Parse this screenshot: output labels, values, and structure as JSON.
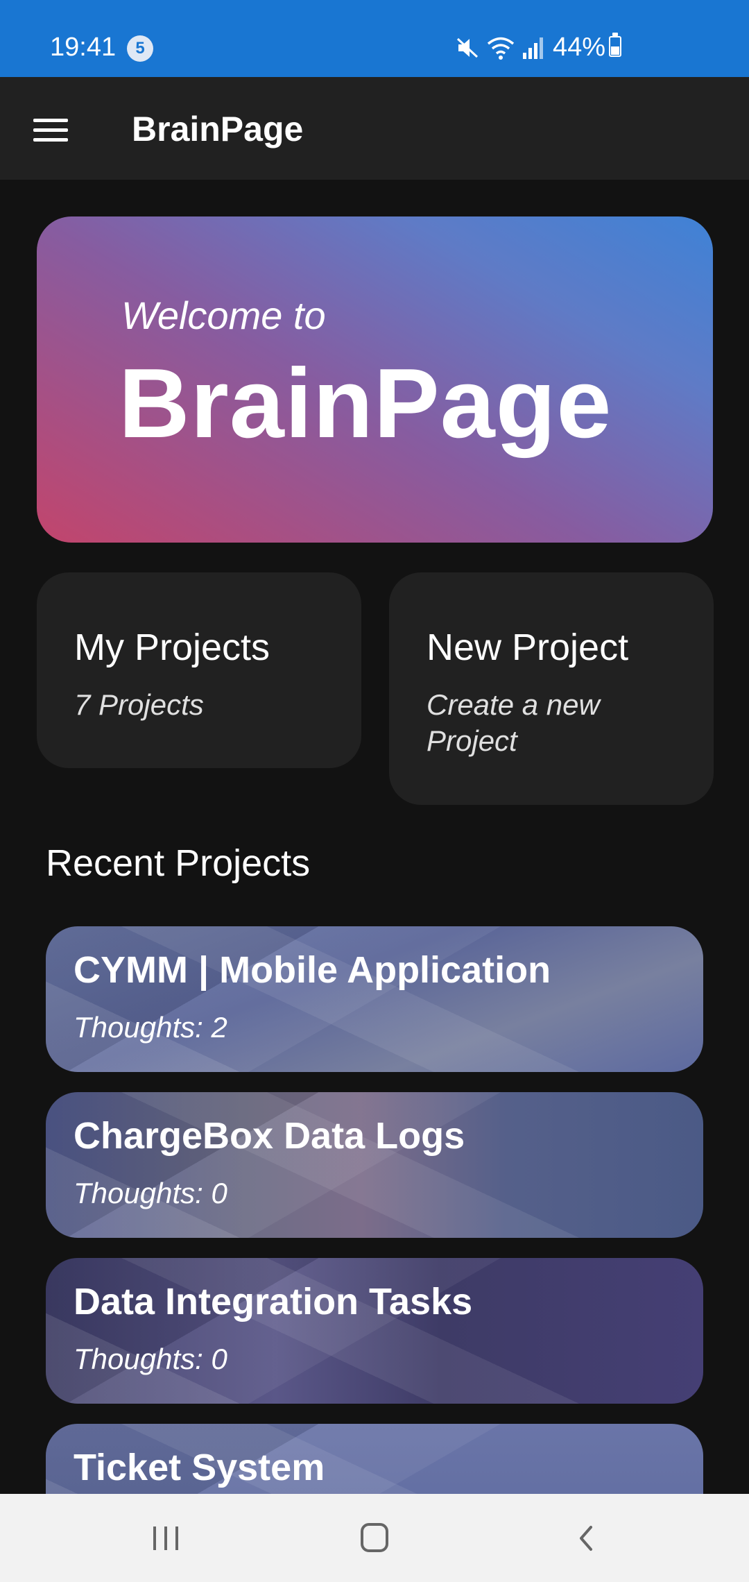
{
  "status_bar": {
    "time": "19:41",
    "notification_count": "5",
    "battery_percent": "44%",
    "icons": [
      "mute-icon",
      "wifi-icon",
      "signal-icon",
      "battery-icon"
    ],
    "background_color": "#1976d2"
  },
  "app_bar": {
    "title": "BrainPage",
    "menu_icon": "hamburger-menu-icon"
  },
  "hero": {
    "welcome": "Welcome to",
    "title": "BrainPage"
  },
  "cards": {
    "my_projects": {
      "title": "My Projects",
      "subtitle": "7 Projects"
    },
    "new_project": {
      "title": "New Project",
      "subtitle": "Create a new Project"
    }
  },
  "recent": {
    "heading": "Recent Projects",
    "projects": [
      {
        "name": "CYMM | Mobile Application",
        "thoughts": "Thoughts: 2"
      },
      {
        "name": "ChargeBox Data Logs",
        "thoughts": "Thoughts: 0"
      },
      {
        "name": "Data Integration Tasks",
        "thoughts": "Thoughts: 0"
      },
      {
        "name": "Ticket System",
        "thoughts": ""
      }
    ]
  },
  "nav_bar": {
    "icons": [
      "recent-apps-icon",
      "home-icon",
      "back-icon"
    ]
  }
}
